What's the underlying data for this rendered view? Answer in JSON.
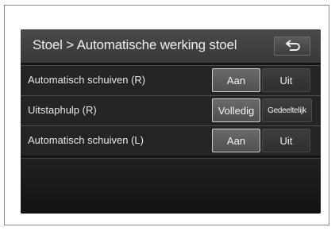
{
  "header": {
    "title": "Stoel > Automatische werking stoel",
    "back_icon": "return-arrow-icon"
  },
  "rows": [
    {
      "label": "Automatisch schuiven (R)",
      "options": [
        "Aan",
        "Uit"
      ],
      "selected": "Aan"
    },
    {
      "label": "Uitstaphulp (R)",
      "options": [
        "Volledig",
        "Gedeeltelijk"
      ],
      "selected": "Volledig"
    },
    {
      "label": "Automatisch schuiven (L)",
      "options": [
        "Aan",
        "Uit"
      ],
      "selected": "Aan"
    }
  ]
}
